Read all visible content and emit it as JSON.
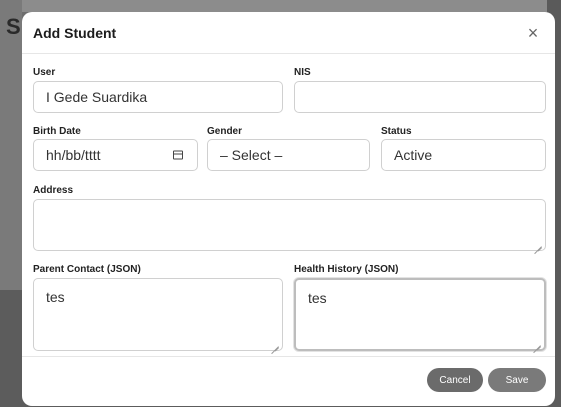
{
  "backdrop": {
    "letter": "S"
  },
  "modal": {
    "title": "Add Student",
    "close_glyph": "×"
  },
  "form": {
    "user": {
      "label": "User",
      "value": "I Gede Suardika"
    },
    "nis": {
      "label": "NIS",
      "value": ""
    },
    "birth_date": {
      "label": "Birth Date",
      "value": "hh/bb/tttt"
    },
    "gender": {
      "label": "Gender",
      "value": "– Select –"
    },
    "status": {
      "label": "Status",
      "value": "Active"
    },
    "address": {
      "label": "Address",
      "value": ""
    },
    "parent_contact": {
      "label": "Parent Contact (JSON)",
      "value": "tes"
    },
    "health_history": {
      "label": "Health History (JSON)",
      "value": "tes"
    }
  },
  "footer": {
    "cancel_label": "Cancel",
    "save_label": "Save"
  },
  "colors": {
    "overlay": "#6e6e6e",
    "modal_bg": "#ffffff",
    "cancel_bg": "#6b6b6b",
    "save_bg": "#7a7a7a"
  }
}
